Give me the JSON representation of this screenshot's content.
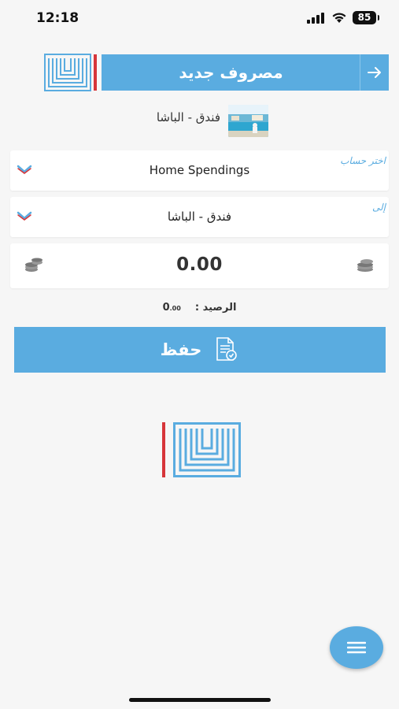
{
  "status_bar": {
    "time": "12:18",
    "battery": "85"
  },
  "header": {
    "title": "مصروف جديد",
    "back_icon": "arrow-right-icon",
    "logo": "app-logo-maze"
  },
  "vendor": {
    "name": "فندق - الباشا",
    "thumbnail": "hotel-pool-photo"
  },
  "account_field": {
    "label": "اختر حساب",
    "value": "Home Spendings"
  },
  "to_field": {
    "label": "إلى",
    "value": "فندق - الباشا"
  },
  "amount_field": {
    "value": "0.00"
  },
  "balance": {
    "label": "الرصيد :",
    "value_int": "0",
    "value_dec": ".00"
  },
  "save_button": {
    "label": "حفظ"
  },
  "colors": {
    "accent": "#5aace0",
    "brand_red": "#d6353a",
    "background": "#f6f6f6"
  }
}
